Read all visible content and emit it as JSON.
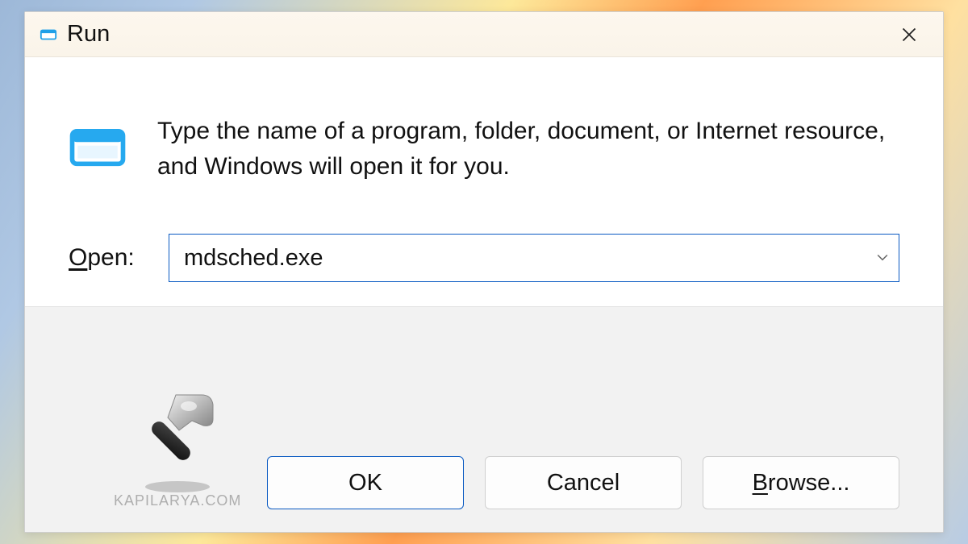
{
  "dialog": {
    "title": "Run",
    "description": "Type the name of a program, folder, document, or Internet resource, and Windows will open it for you.",
    "open_label_prefix": "O",
    "open_label_rest": "pen:",
    "input_value": "mdsched.exe",
    "buttons": {
      "ok": "OK",
      "cancel": "Cancel",
      "browse_prefix": "B",
      "browse_rest": "rowse..."
    }
  },
  "watermark": "KAPILARYA.COM"
}
